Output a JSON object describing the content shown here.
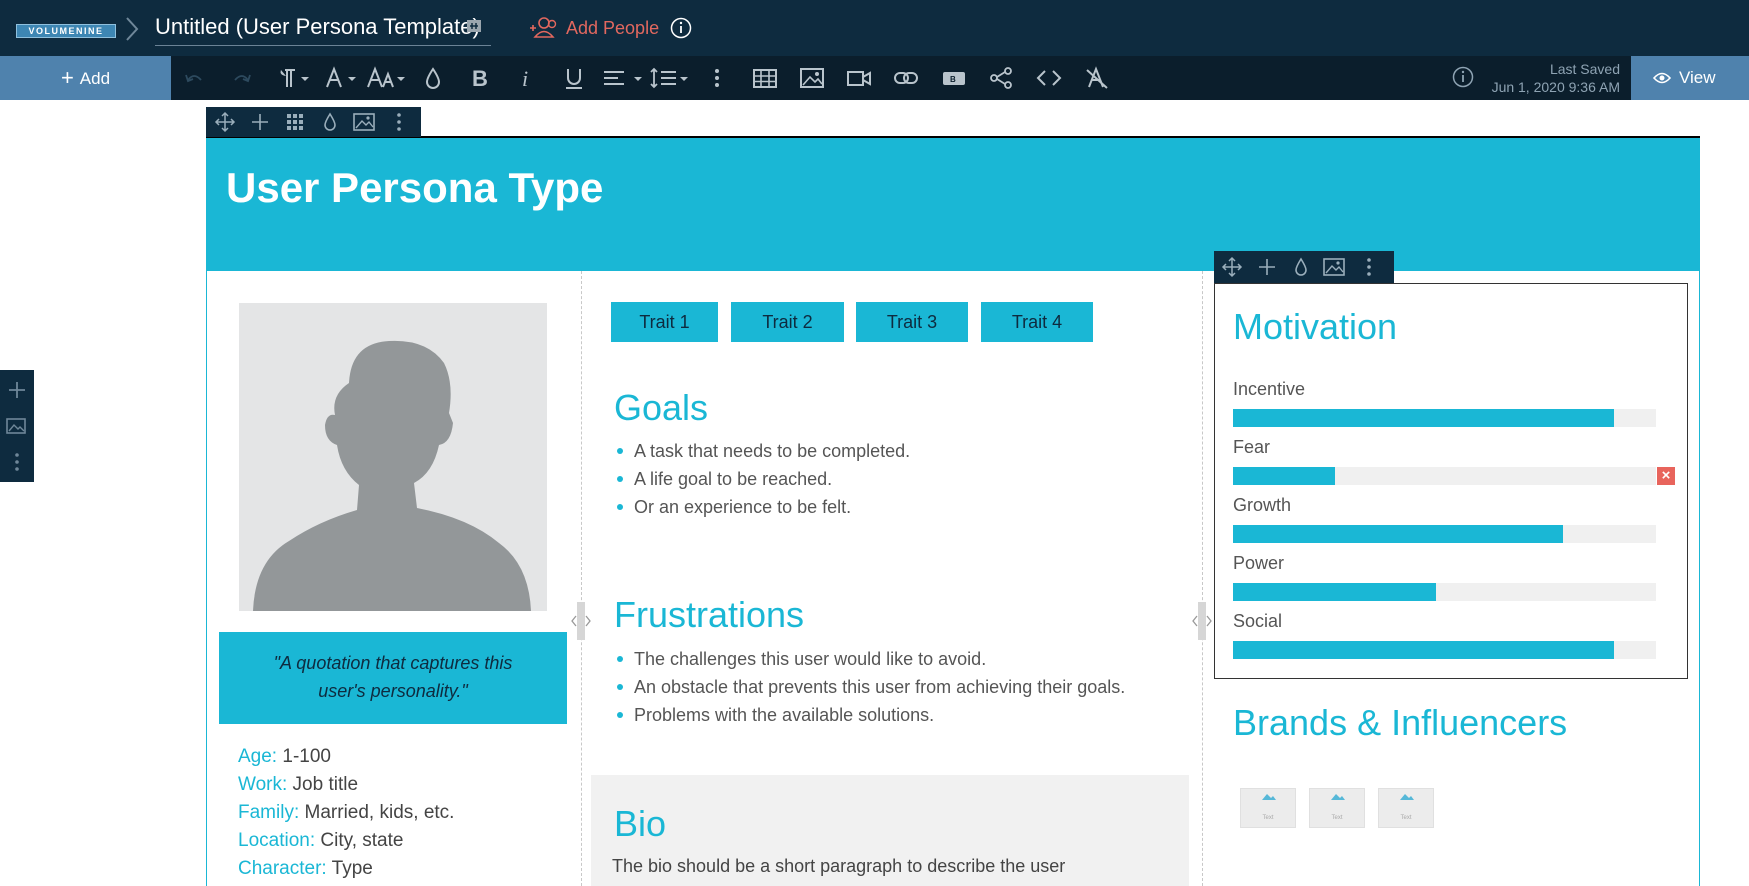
{
  "app": {
    "logo_text": "VOLUMENINE",
    "doc_title": "Untitled (User Persona Template)",
    "add_people": "Add People"
  },
  "toolbar": {
    "add_label": "Add",
    "last_saved_label": "Last Saved",
    "last_saved_time": "Jun 1, 2020 9:36 AM",
    "view_label": "View",
    "icons": [
      "undo-icon",
      "redo-icon",
      "paragraph-icon",
      "font-icon",
      "font-size-icon",
      "text-color-icon",
      "bold-icon",
      "italic-icon",
      "underline-icon",
      "align-icon",
      "line-height-icon",
      "more-icon",
      "table-icon",
      "image-icon",
      "video-icon",
      "link-icon",
      "button-icon",
      "share-icon",
      "code-icon",
      "clear-format-icon"
    ]
  },
  "page": {
    "title": "User Persona Type"
  },
  "persona": {
    "quote": "\"A quotation that captures this user's personality.\"",
    "info": [
      {
        "key": "Age:",
        "value": "1-100"
      },
      {
        "key": "Work:",
        "value": "Job title"
      },
      {
        "key": "Family:",
        "value": "Married, kids, etc."
      },
      {
        "key": "Location:",
        "value": "City, state"
      },
      {
        "key": "Character:",
        "value": "Type"
      }
    ]
  },
  "traits": [
    "Trait 1",
    "Trait 2",
    "Trait 3",
    "Trait 4"
  ],
  "goals": {
    "heading": "Goals",
    "items": [
      "A task that needs to be completed.",
      "A life goal to be reached.",
      "Or an experience to be felt."
    ]
  },
  "frustrations": {
    "heading": "Frustrations",
    "items": [
      "The challenges this user would like to avoid.",
      "An obstacle that prevents this user from achieving their goals.",
      "Problems with the available solutions."
    ]
  },
  "bio": {
    "heading": "Bio",
    "text": "The bio should be a short paragraph to describe the user"
  },
  "motivation": {
    "heading": "Motivation",
    "bars": [
      {
        "label": "Incentive",
        "value": 0.9
      },
      {
        "label": "Fear",
        "value": 0.24
      },
      {
        "label": "Growth",
        "value": 0.78
      },
      {
        "label": "Power",
        "value": 0.48
      },
      {
        "label": "Social",
        "value": 0.9
      }
    ]
  },
  "brands": {
    "heading": "Brands & Influencers",
    "logos": [
      "Text",
      "Text",
      "Text"
    ]
  },
  "colors": {
    "accent": "#1ab7d5",
    "topbar": "#0e2b3f",
    "toolbar": "#0b1e2c",
    "button": "#4f82ad",
    "delete": "#e8645c"
  }
}
